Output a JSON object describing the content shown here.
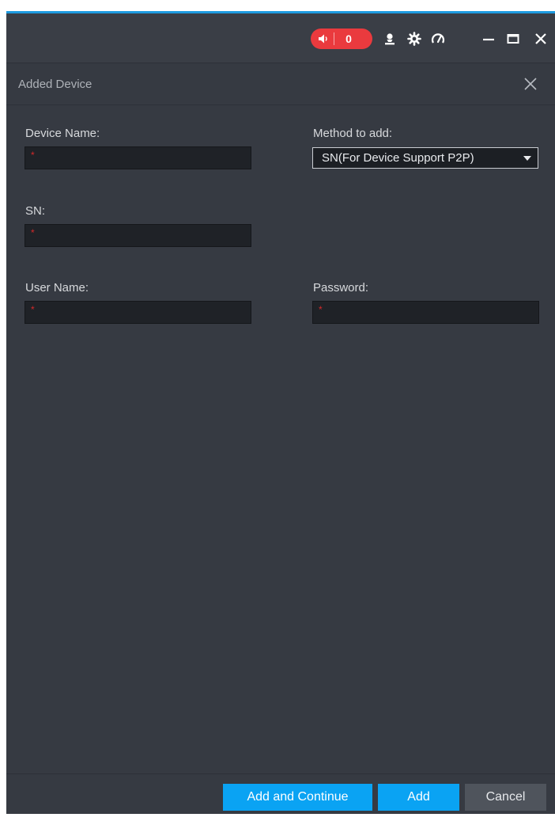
{
  "titlebar": {
    "alarm_count": "0",
    "icons": [
      "speaker-icon",
      "user-icon",
      "gear-icon",
      "speedometer-icon",
      "minimize-icon",
      "maximize-icon",
      "close-icon"
    ]
  },
  "dialog": {
    "title": "Added Device",
    "close_icon": "close-icon"
  },
  "form": {
    "device_name_label": "Device Name:",
    "device_name_value": "",
    "method_label": "Method to add:",
    "method_value": "SN(For Device Support P2P)",
    "sn_label": "SN:",
    "sn_value": "",
    "user_name_label": "User Name:",
    "user_name_value": "",
    "password_label": "Password:",
    "password_value": "",
    "required_mark": "*"
  },
  "footer": {
    "add_continue_label": "Add and Continue",
    "add_label": "Add",
    "cancel_label": "Cancel"
  },
  "colors": {
    "background": "#363a42",
    "accent": "#0aa3f3",
    "alarm": "#ea3a3e",
    "required": "#d42a2a"
  }
}
